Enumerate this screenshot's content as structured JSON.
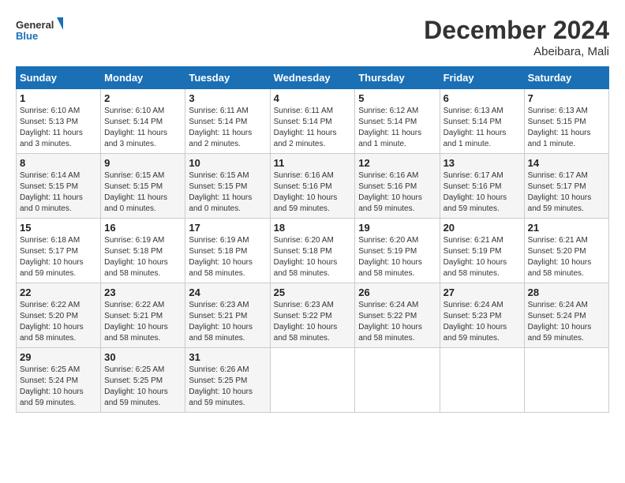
{
  "header": {
    "logo_general": "General",
    "logo_blue": "Blue",
    "month_year": "December 2024",
    "location": "Abeibara, Mali"
  },
  "weekdays": [
    "Sunday",
    "Monday",
    "Tuesday",
    "Wednesday",
    "Thursday",
    "Friday",
    "Saturday"
  ],
  "weeks": [
    [
      {
        "day": "1",
        "sunrise": "6:10 AM",
        "sunset": "5:13 PM",
        "daylight": "11 hours and 3 minutes."
      },
      {
        "day": "2",
        "sunrise": "6:10 AM",
        "sunset": "5:14 PM",
        "daylight": "11 hours and 3 minutes."
      },
      {
        "day": "3",
        "sunrise": "6:11 AM",
        "sunset": "5:14 PM",
        "daylight": "11 hours and 2 minutes."
      },
      {
        "day": "4",
        "sunrise": "6:11 AM",
        "sunset": "5:14 PM",
        "daylight": "11 hours and 2 minutes."
      },
      {
        "day": "5",
        "sunrise": "6:12 AM",
        "sunset": "5:14 PM",
        "daylight": "11 hours and 1 minute."
      },
      {
        "day": "6",
        "sunrise": "6:13 AM",
        "sunset": "5:14 PM",
        "daylight": "11 hours and 1 minute."
      },
      {
        "day": "7",
        "sunrise": "6:13 AM",
        "sunset": "5:15 PM",
        "daylight": "11 hours and 1 minute."
      }
    ],
    [
      {
        "day": "8",
        "sunrise": "6:14 AM",
        "sunset": "5:15 PM",
        "daylight": "11 hours and 0 minutes."
      },
      {
        "day": "9",
        "sunrise": "6:15 AM",
        "sunset": "5:15 PM",
        "daylight": "11 hours and 0 minutes."
      },
      {
        "day": "10",
        "sunrise": "6:15 AM",
        "sunset": "5:15 PM",
        "daylight": "11 hours and 0 minutes."
      },
      {
        "day": "11",
        "sunrise": "6:16 AM",
        "sunset": "5:16 PM",
        "daylight": "10 hours and 59 minutes."
      },
      {
        "day": "12",
        "sunrise": "6:16 AM",
        "sunset": "5:16 PM",
        "daylight": "10 hours and 59 minutes."
      },
      {
        "day": "13",
        "sunrise": "6:17 AM",
        "sunset": "5:16 PM",
        "daylight": "10 hours and 59 minutes."
      },
      {
        "day": "14",
        "sunrise": "6:17 AM",
        "sunset": "5:17 PM",
        "daylight": "10 hours and 59 minutes."
      }
    ],
    [
      {
        "day": "15",
        "sunrise": "6:18 AM",
        "sunset": "5:17 PM",
        "daylight": "10 hours and 59 minutes."
      },
      {
        "day": "16",
        "sunrise": "6:19 AM",
        "sunset": "5:18 PM",
        "daylight": "10 hours and 58 minutes."
      },
      {
        "day": "17",
        "sunrise": "6:19 AM",
        "sunset": "5:18 PM",
        "daylight": "10 hours and 58 minutes."
      },
      {
        "day": "18",
        "sunrise": "6:20 AM",
        "sunset": "5:18 PM",
        "daylight": "10 hours and 58 minutes."
      },
      {
        "day": "19",
        "sunrise": "6:20 AM",
        "sunset": "5:19 PM",
        "daylight": "10 hours and 58 minutes."
      },
      {
        "day": "20",
        "sunrise": "6:21 AM",
        "sunset": "5:19 PM",
        "daylight": "10 hours and 58 minutes."
      },
      {
        "day": "21",
        "sunrise": "6:21 AM",
        "sunset": "5:20 PM",
        "daylight": "10 hours and 58 minutes."
      }
    ],
    [
      {
        "day": "22",
        "sunrise": "6:22 AM",
        "sunset": "5:20 PM",
        "daylight": "10 hours and 58 minutes."
      },
      {
        "day": "23",
        "sunrise": "6:22 AM",
        "sunset": "5:21 PM",
        "daylight": "10 hours and 58 minutes."
      },
      {
        "day": "24",
        "sunrise": "6:23 AM",
        "sunset": "5:21 PM",
        "daylight": "10 hours and 58 minutes."
      },
      {
        "day": "25",
        "sunrise": "6:23 AM",
        "sunset": "5:22 PM",
        "daylight": "10 hours and 58 minutes."
      },
      {
        "day": "26",
        "sunrise": "6:24 AM",
        "sunset": "5:22 PM",
        "daylight": "10 hours and 58 minutes."
      },
      {
        "day": "27",
        "sunrise": "6:24 AM",
        "sunset": "5:23 PM",
        "daylight": "10 hours and 59 minutes."
      },
      {
        "day": "28",
        "sunrise": "6:24 AM",
        "sunset": "5:24 PM",
        "daylight": "10 hours and 59 minutes."
      }
    ],
    [
      {
        "day": "29",
        "sunrise": "6:25 AM",
        "sunset": "5:24 PM",
        "daylight": "10 hours and 59 minutes."
      },
      {
        "day": "30",
        "sunrise": "6:25 AM",
        "sunset": "5:25 PM",
        "daylight": "10 hours and 59 minutes."
      },
      {
        "day": "31",
        "sunrise": "6:26 AM",
        "sunset": "5:25 PM",
        "daylight": "10 hours and 59 minutes."
      },
      null,
      null,
      null,
      null
    ]
  ]
}
